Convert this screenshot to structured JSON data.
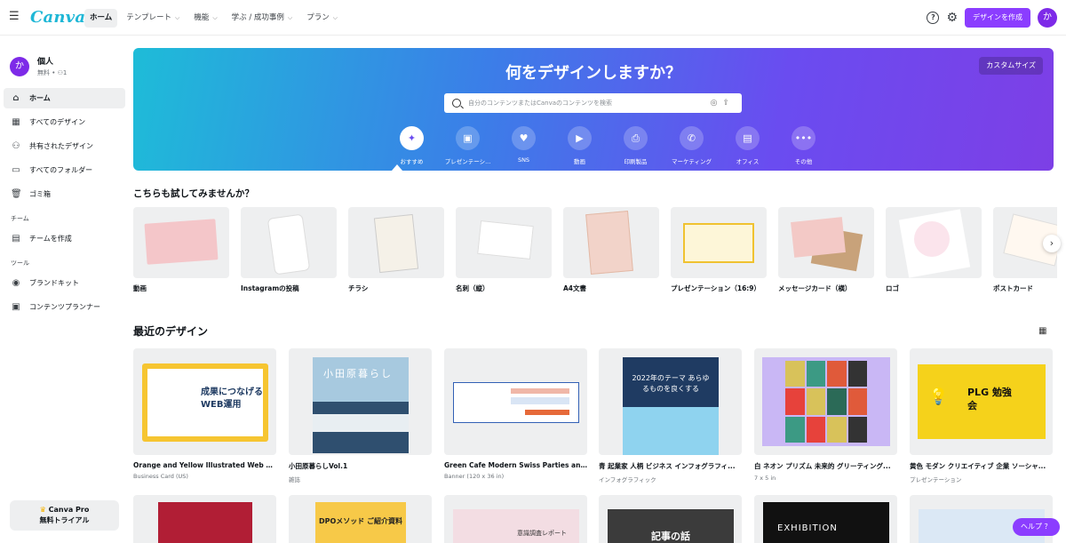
{
  "topbar": {
    "logo": "Canva",
    "nav": [
      {
        "label": "ホーム",
        "chevron": false
      },
      {
        "label": "テンプレート",
        "chevron": true
      },
      {
        "label": "機能",
        "chevron": true
      },
      {
        "label": "学ぶ / 成功事例",
        "chevron": true
      },
      {
        "label": "プラン",
        "chevron": true
      }
    ],
    "help_icon": "?",
    "create_label": "デザインを作成",
    "avatar_initial": "か"
  },
  "sidebar": {
    "account_initial": "か",
    "account_name": "個人",
    "account_sub": "無料 • ⚇1",
    "items": [
      {
        "label": "ホーム",
        "icon": "home-icon",
        "glyph": "⌂"
      },
      {
        "label": "すべてのデザイン",
        "icon": "grid-icon",
        "glyph": "▦"
      },
      {
        "label": "共有されたデザイン",
        "icon": "shared-icon",
        "glyph": "⚇"
      },
      {
        "label": "すべてのフォルダー",
        "icon": "folder-icon",
        "glyph": "▭"
      },
      {
        "label": "ゴミ箱",
        "icon": "trash-icon",
        "glyph": "🗑"
      }
    ],
    "team_section": "チーム",
    "team_items": [
      {
        "label": "チームを作成",
        "icon": "team-icon",
        "glyph": "▤"
      }
    ],
    "tools_section": "ツール",
    "tools_items": [
      {
        "label": "ブランドキット",
        "icon": "brand-kit-icon",
        "glyph": "◉"
      },
      {
        "label": "コンテンツプランナー",
        "icon": "calendar-icon",
        "glyph": "▣"
      }
    ],
    "pro_line1": "Canva Pro",
    "pro_line2": "無料トライアル"
  },
  "hero": {
    "title": "何をデザインしますか？",
    "custom_size": "カスタムサイズ",
    "search_placeholder": "自分のコンテンツまたはCanvaのコンテンツを検索",
    "categories": [
      {
        "label": "おすすめ",
        "glyph": "✦",
        "icon": "sparkle-icon"
      },
      {
        "label": "プレゼンテーシ...",
        "glyph": "▣",
        "icon": "presentation-icon"
      },
      {
        "label": "SNS",
        "glyph": "♥",
        "icon": "heart-icon"
      },
      {
        "label": "動画",
        "glyph": "▶",
        "icon": "video-icon"
      },
      {
        "label": "印刷製品",
        "glyph": "⎙",
        "icon": "printer-icon"
      },
      {
        "label": "マーケティング",
        "glyph": "✆",
        "icon": "megaphone-icon"
      },
      {
        "label": "オフィス",
        "glyph": "▤",
        "icon": "briefcase-icon"
      },
      {
        "label": "その他",
        "glyph": "•••",
        "icon": "more-icon"
      }
    ]
  },
  "try_section": {
    "title": "こちらも試してみませんか？",
    "items": [
      {
        "label": "動画",
        "color": "#f4c6c9"
      },
      {
        "label": "Instagramの投稿",
        "color": "#ffffff"
      },
      {
        "label": "チラシ",
        "color": "#f5f1e8"
      },
      {
        "label": "名刺（縦）",
        "color": "#ffffff"
      },
      {
        "label": "A4文書",
        "color": "#f2d3c9"
      },
      {
        "label": "プレゼンテーション（16:9）",
        "color": "#fdf6d8"
      },
      {
        "label": "メッセージカード（横）",
        "color": "#f3c9c6"
      },
      {
        "label": "ロゴ",
        "color": "#fbe4ec"
      },
      {
        "label": "ポストカード",
        "color": "#fff8f0"
      }
    ]
  },
  "recent_section": {
    "title": "最近のデザイン",
    "items": [
      {
        "title": "Orange and Yellow Illustrated Web Desig...",
        "sub": "Business Card (US)",
        "color": "#f6c531",
        "thumb_text": "成果につなげるWEB運用"
      },
      {
        "title": "小田原暮らしVol.1",
        "sub": "雑誌",
        "color": "#2f4f6f",
        "thumb_text": "小田原暮らし"
      },
      {
        "title": "Green Cafe Modern Swiss Parties and Cel...",
        "sub": "Banner (120 x 36 in)",
        "color": "#ffffff",
        "thumb_text": ""
      },
      {
        "title": "青 起業家 人柄 ビジネス インフォグラフィ...",
        "sub": "インフォグラフィック",
        "color": "#1f3b62",
        "thumb_text": "2022年のテーマ あらゆるものを良くする"
      },
      {
        "title": "白 ネオン プリズム 未来的 グリーティング...",
        "sub": "7 x 5 in",
        "color": "#c9b7f5",
        "thumb_text": ""
      },
      {
        "title": "黄色 モダン クリエイティブ 企業 ソーシャ...",
        "sub": "プレゼンテーション",
        "color": "#f5d21b",
        "thumb_text": "PLG 勉強会"
      }
    ]
  },
  "bottom_thumbs": [
    {
      "color": "#b11e35"
    },
    {
      "color": "#f7c948",
      "text": "DPOメソッド ご紹介資料"
    },
    {
      "color": "#f3dde3",
      "text": "意識調査レポート"
    },
    {
      "color": "#3b3b3b",
      "text": "記事の話"
    },
    {
      "color": "#111111",
      "text": "EXHIBITION"
    },
    {
      "color": "#dbe8f5",
      "text": ""
    }
  ],
  "help_label": "ヘルプ ？"
}
